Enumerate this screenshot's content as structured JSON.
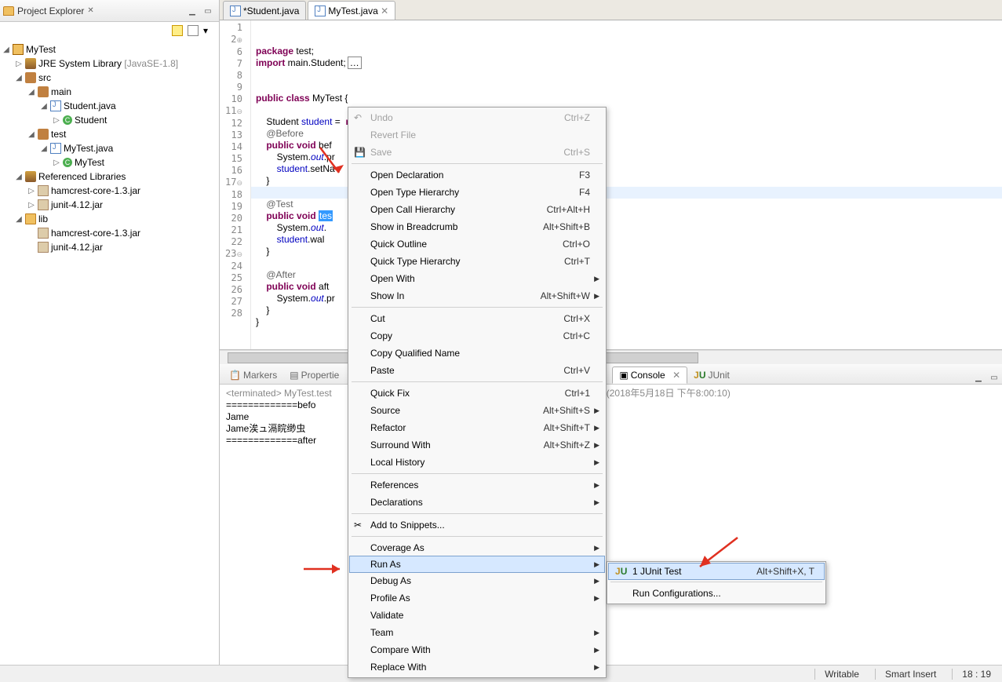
{
  "explorer": {
    "title": "Project Explorer"
  },
  "tree": {
    "project": "MyTest",
    "jre": "JRE System Library",
    "jre_deco": "[JavaSE-1.8]",
    "src": "src",
    "main": "main",
    "studentjava": "Student.java",
    "studentcls": "Student",
    "test": "test",
    "mytestjava": "MyTest.java",
    "mytestcls": "MyTest",
    "refs": "Referenced Libraries",
    "jar1": "hamcrest-core-1.3.jar",
    "jar2": "junit-4.12.jar",
    "lib": "lib"
  },
  "tabs": {
    "t1": "*Student.java",
    "t2": "MyTest.java"
  },
  "code": {
    "l1": "package test;",
    "l2": "import main.Student;",
    "l5": "public class MyTest {",
    "l7": "    Student student =  new Student();",
    "l8": "    @Before",
    "l9": "    public void bef",
    "l10": "        System.out.pr",
    "l11": "        student.setNa",
    "l12": "    }",
    "l14": "    @Test",
    "l15": "    public void ",
    "sel": "tes",
    "l16": "        System.out.",
    "l17": "        student.wal",
    "l18": "    }",
    "l20": "    @After",
    "l21": "    public void aft",
    "l22": "        System.out.pr",
    "l22b": "=\");",
    "l23": "    }",
    "l24": "}"
  },
  "btabs": {
    "markers": "Markers",
    "props": "Propertie",
    "console": "Console",
    "junit": "JUnit"
  },
  "console": {
    "l1": "<terminated> MyTest.test",
    "l1b": "e (2018年5月18日 下午8:00:10)",
    "l2": "=============befo",
    "l3": "Jame",
    "l4": "Jame涘ュ滆睆缈虫",
    "l5": "=============after"
  },
  "menu": {
    "undo": "Undo",
    "revert": "Revert File",
    "save": "Save",
    "opendecl": "Open Declaration",
    "openhier": "Open Type Hierarchy",
    "opencall": "Open Call Hierarchy",
    "bread": "Show in Breadcrumb",
    "qout": "Quick Outline",
    "qtype": "Quick Type Hierarchy",
    "openwith": "Open With",
    "showin": "Show In",
    "cut": "Cut",
    "copy": "Copy",
    "copyq": "Copy Qualified Name",
    "paste": "Paste",
    "qfix": "Quick Fix",
    "source": "Source",
    "refactor": "Refactor",
    "surround": "Surround With",
    "local": "Local History",
    "refs": "References",
    "decls": "Declarations",
    "snip": "Add to Snippets...",
    "cov": "Coverage As",
    "run": "Run As",
    "debug": "Debug As",
    "profile": "Profile As",
    "validate": "Validate",
    "team": "Team",
    "compare": "Compare With",
    "replace": "Replace With"
  },
  "keys": {
    "undo": "Ctrl+Z",
    "save": "Ctrl+S",
    "opendecl": "F3",
    "openhier": "F4",
    "opencall": "Ctrl+Alt+H",
    "bread": "Alt+Shift+B",
    "qout": "Ctrl+O",
    "qtype": "Ctrl+T",
    "showin": "Alt+Shift+W",
    "cut": "Ctrl+X",
    "copy": "Ctrl+C",
    "paste": "Ctrl+V",
    "qfix": "Ctrl+1",
    "source": "Alt+Shift+S",
    "refactor": "Alt+Shift+T",
    "surround": "Alt+Shift+Z"
  },
  "submenu": {
    "junit": "1 JUnit Test",
    "junitkey": "Alt+Shift+X, T",
    "runconf": "Run Configurations..."
  },
  "status": {
    "writable": "Writable",
    "insert": "Smart Insert",
    "pos": "18 : 19"
  }
}
